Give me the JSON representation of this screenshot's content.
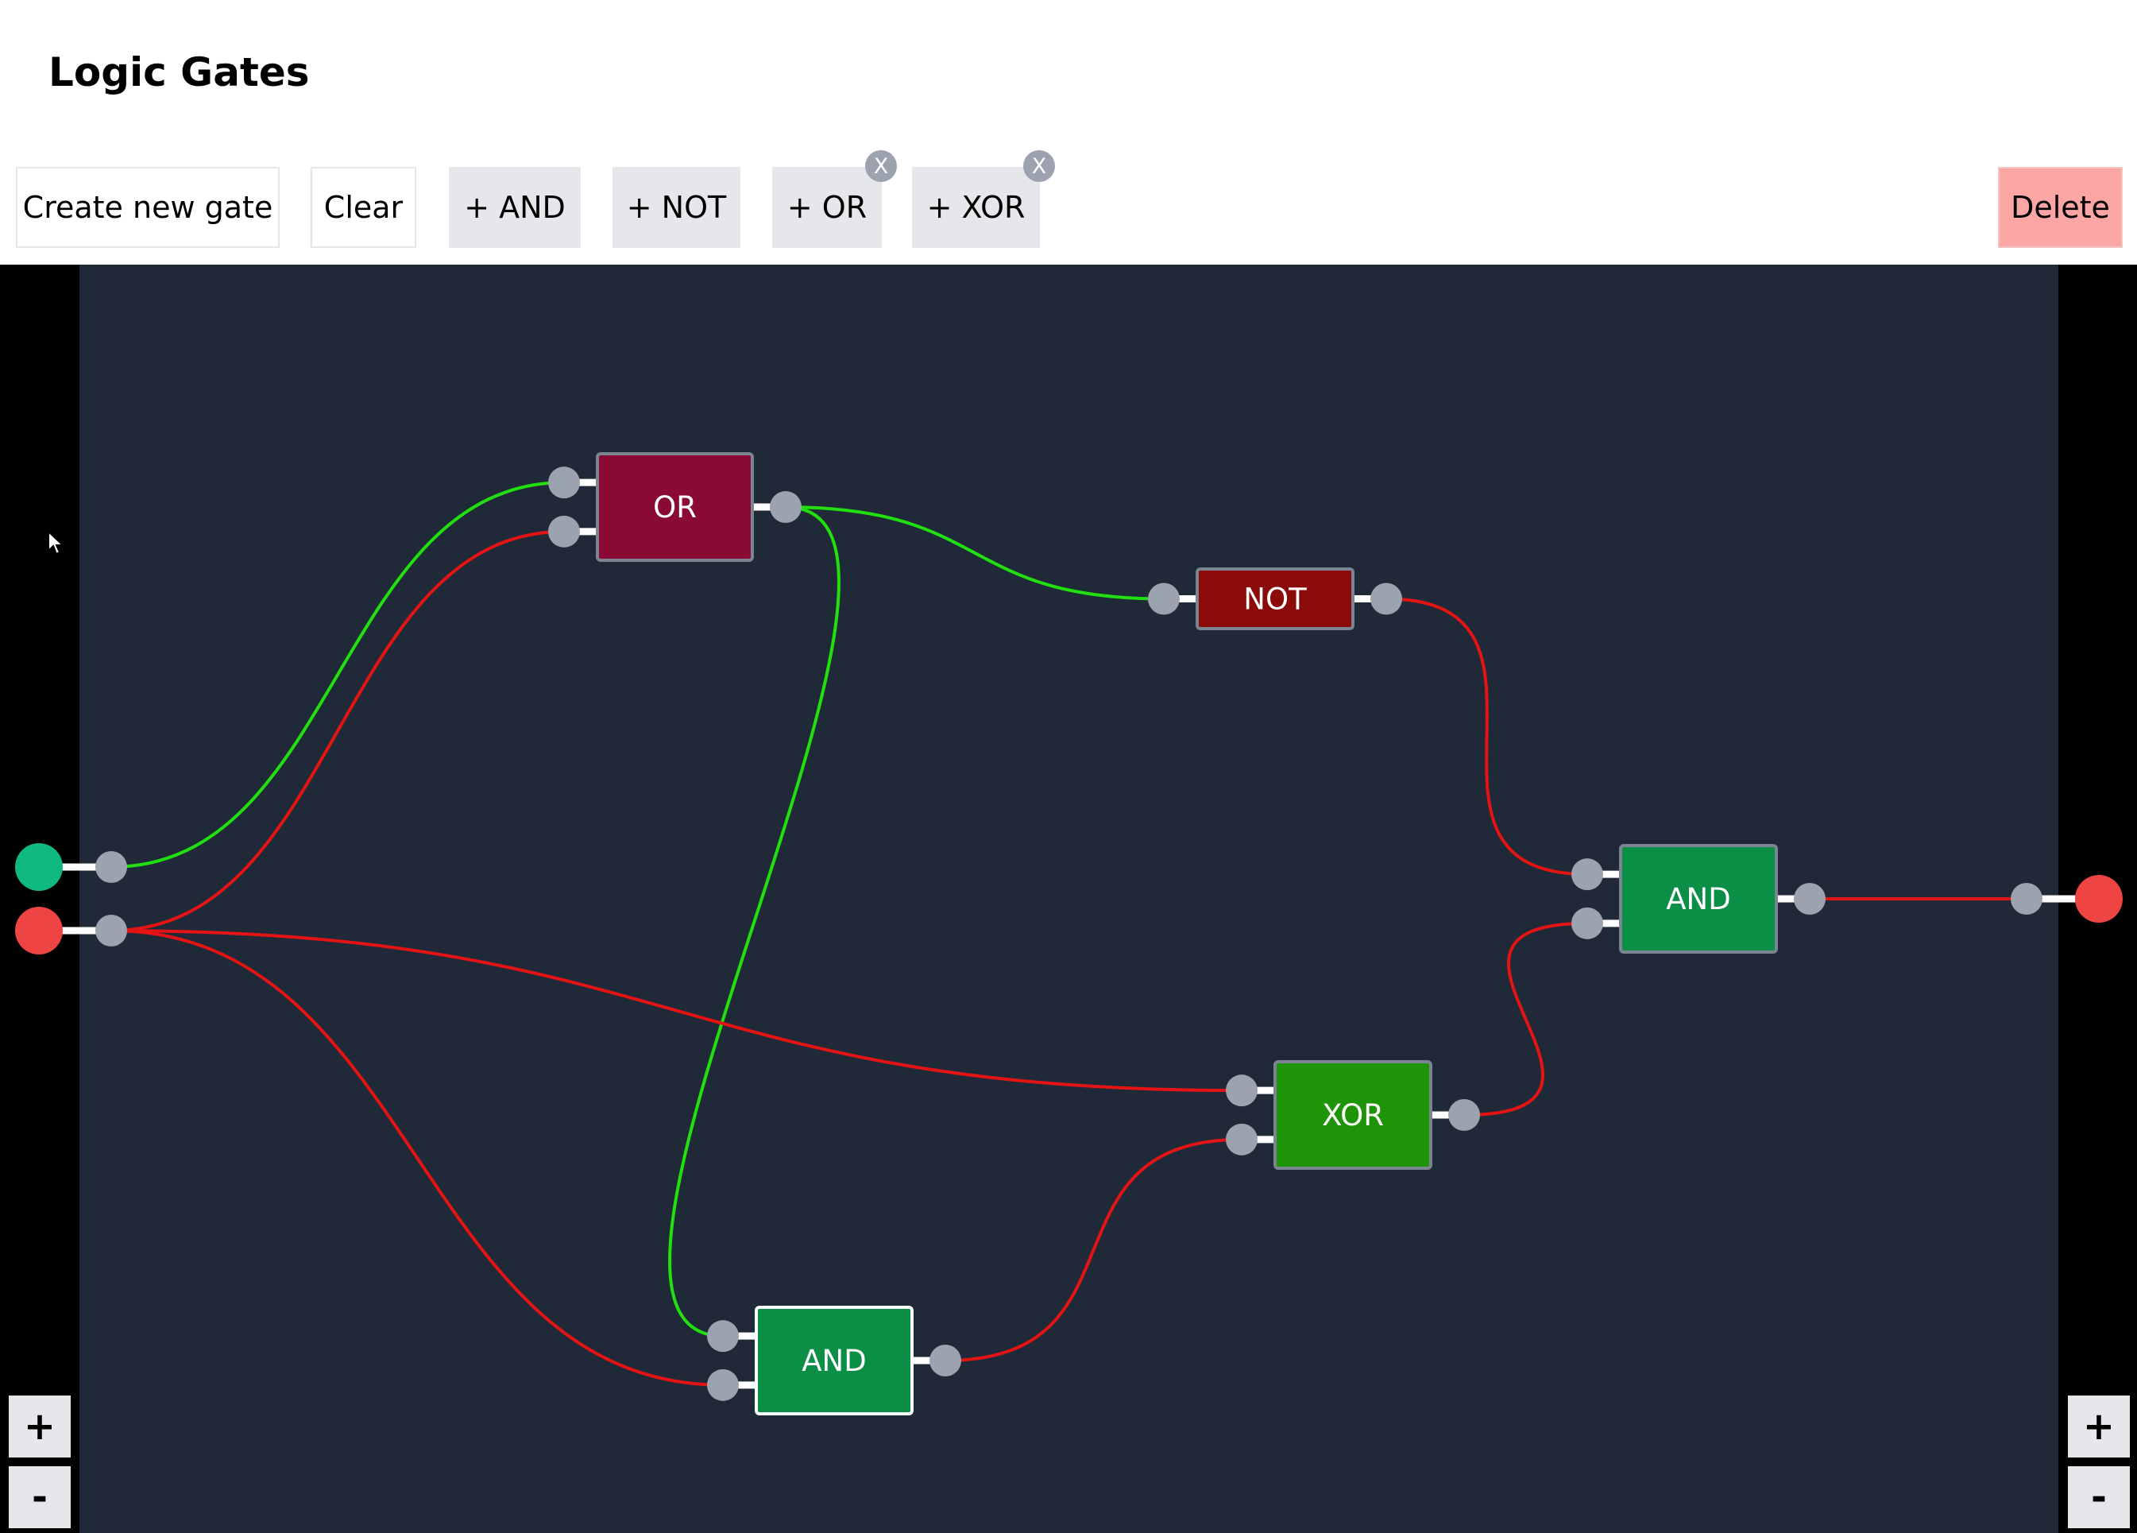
{
  "app": {
    "title": "Logic Gates"
  },
  "toolbar": {
    "create_new_gate": "Create new gate",
    "clear": "Clear",
    "add_and": "+ AND",
    "add_not": "+ NOT",
    "add_or": "+ OR",
    "add_xor": "+ XOR",
    "remove_mark": "X",
    "delete": "Delete"
  },
  "zoom": {
    "plus": "+",
    "minus": "-"
  },
  "colors": {
    "workspace": "#1f2937",
    "wire_on": "#22e010",
    "wire_off": "#e51414",
    "pin": "#9ca3af",
    "io_on": "#10b981",
    "io_off": "#ef4444",
    "gate_or": "#8b0a35",
    "gate_not": "#8b0a0a",
    "gate_and": "#0b8f46",
    "gate_xor": "#1e9409"
  },
  "circuit": {
    "inputs": [
      {
        "id": "in1",
        "state": "on"
      },
      {
        "id": "in2",
        "state": "off"
      }
    ],
    "outputs": [
      {
        "id": "out1",
        "state": "off"
      }
    ],
    "gates": [
      {
        "id": "or1",
        "type": "OR",
        "label": "OR",
        "output_state": "on",
        "selected": false
      },
      {
        "id": "not1",
        "type": "NOT",
        "label": "NOT",
        "output_state": "off",
        "selected": false
      },
      {
        "id": "and1",
        "type": "AND",
        "label": "AND",
        "output_state": "off",
        "selected": false
      },
      {
        "id": "xor1",
        "type": "XOR",
        "label": "XOR",
        "output_state": "off",
        "selected": false
      },
      {
        "id": "and2",
        "type": "AND",
        "label": "AND",
        "output_state": "off",
        "selected": true
      }
    ],
    "wires": [
      {
        "from": "in1",
        "to": "or1.in0",
        "state": "on"
      },
      {
        "from": "in2",
        "to": "or1.in1",
        "state": "off"
      },
      {
        "from": "or1.out",
        "to": "not1.in0",
        "state": "on"
      },
      {
        "from": "or1.out",
        "to": "and2.in0",
        "state": "on"
      },
      {
        "from": "in2",
        "to": "xor1.in0",
        "state": "off"
      },
      {
        "from": "in2",
        "to": "and2.in1",
        "state": "off"
      },
      {
        "from": "not1.out",
        "to": "and1.in0",
        "state": "off"
      },
      {
        "from": "xor1.out",
        "to": "and1.in1",
        "state": "off"
      },
      {
        "from": "and2.out",
        "to": "xor1.in1",
        "state": "off"
      },
      {
        "from": "and1.out",
        "to": "out1",
        "state": "off"
      }
    ]
  }
}
